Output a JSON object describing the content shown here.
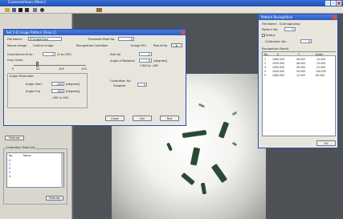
{
  "app": {
    "title": "CameraVision [Main]"
  },
  "toolbar": {
    "icons": [
      "open-icon",
      "save-icon",
      "grab-icon",
      "stop-icon",
      "settings-icon",
      "zoom-icon",
      "help-icon"
    ]
  },
  "dialog": {
    "title": "Set 2-D Image Pattern [Area 1]",
    "file_name_label": "File Name:",
    "file_name_value": "D:\\image.bmp",
    "threshold_label": "Threshold Pixel No:",
    "threshold_value": "0",
    "mode_left": "Mouse Image",
    "mode_mid": "Outline Image",
    "mode_right": "Image ROI",
    "recognition_label": "Recognition Condition",
    "image_size_label": "Image Size:",
    "result_label": "Result No.",
    "resolution_label": "Coincidence Error:",
    "resolution_value": "1",
    "resolution_unit": "(0 to 255)",
    "offset_label": "Gray Scale",
    "slider_min": "0",
    "slider_mid1": "50",
    "slider_mid2": "100",
    "slider_max": "120",
    "edit_no_label": "Edit No",
    "edit_no_value": "1",
    "angle_of_rotation_label": "Angle of Rotation",
    "angle_of_rotation_value": "0",
    "angle_unit": "[degrees]",
    "angle_limit": "+180 to -180",
    "rotation_group_label": "Angle Parameter",
    "angle_start_label": "Angle Start",
    "angle_start_value": "-180",
    "angle_end_label": "Angle End",
    "angle_end_value": "180",
    "angle_range": "-180 to 180",
    "calibration_label": "Calibration No",
    "calibration_sub": "Subpixel",
    "calibration_value": "0",
    "close_button": "Close",
    "set_button": "Set",
    "test_button": "Test"
  },
  "left_panel": {
    "reset_button": "Redraw",
    "list_title": "Calibration Data List",
    "list_headers": [
      "No.",
      "Name"
    ],
    "list_rows": [
      "0",
      "1",
      "2",
      "3",
      "4"
    ],
    "bottom_button": "Redraw"
  },
  "result_window": {
    "title": "Pattern Recognition",
    "file_label": "File Name:",
    "file_value": "D:\\image.bmp",
    "pattern_label": "Pattern No:",
    "pattern_value": "1",
    "status_label": "Status",
    "calib_label": "Calibration No:",
    "calib_value": "0",
    "result_title": "Recognition Result",
    "headers": [
      "No",
      "X",
      "Y",
      "Angle"
    ],
    "rows": [
      [
        "1",
        "1060.000",
        "56.000",
        "-12.000"
      ],
      [
        "2",
        "1050.000",
        "48.000",
        "-75.000"
      ],
      [
        "3",
        "1090.000",
        "56.000",
        "-12.000"
      ],
      [
        "4",
        "1040.000",
        "54.000",
        "120.000"
      ],
      [
        "5",
        "1060.000",
        "12.000",
        "60.000"
      ]
    ],
    "ok_button": "OK"
  },
  "colors": {
    "title_blue": "#2a5cc4",
    "parts": "#2c4a33",
    "background": "#5b5e63"
  }
}
